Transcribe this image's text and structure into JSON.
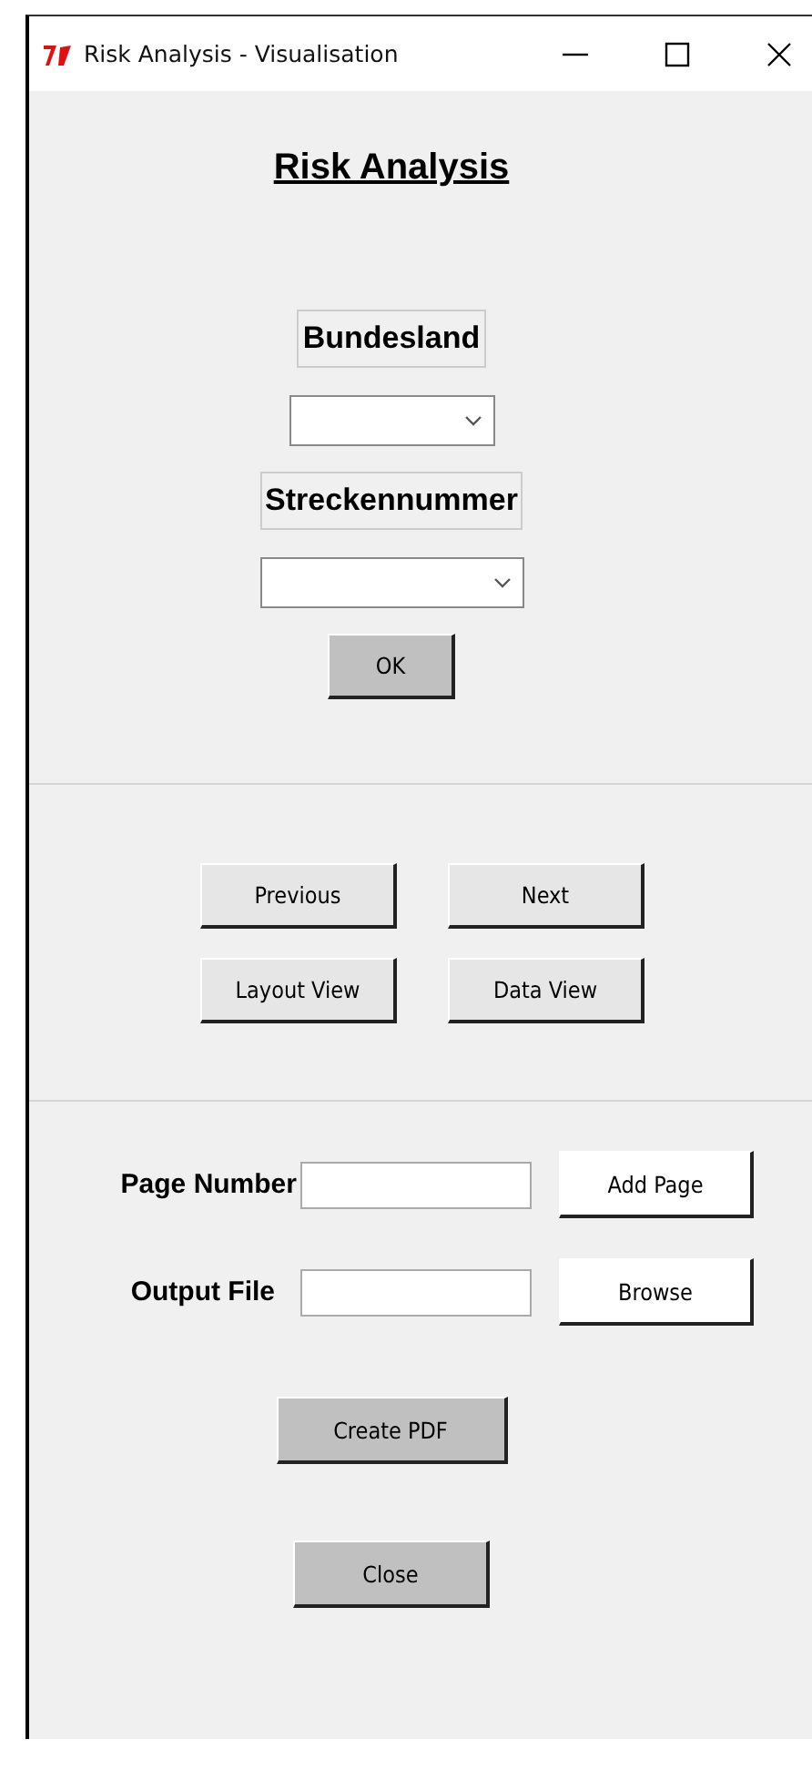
{
  "window": {
    "title": "Risk Analysis - Visualisation"
  },
  "heading": "Risk Analysis",
  "selection": [
    {
      "label": "Bundesland"
    },
    {
      "label": "Streckennummer"
    }
  ],
  "ok_button": {
    "label": "OK",
    "kind": "dark"
  },
  "navigation": [
    {
      "label": "Previous",
      "kind": "light"
    },
    {
      "label": "Next",
      "kind": "light"
    },
    {
      "label": "Layout View",
      "kind": "light"
    },
    {
      "label": "Data View",
      "kind": "light"
    }
  ],
  "export_rows": [
    {
      "label": "Page Number",
      "button": "Add Page",
      "kind": "white"
    },
    {
      "label": "Output File",
      "button": "Browse",
      "kind": "white"
    }
  ],
  "actions": [
    {
      "label": "Create PDF",
      "kind": "dark"
    },
    {
      "label": "Close",
      "kind": "dark"
    }
  ]
}
